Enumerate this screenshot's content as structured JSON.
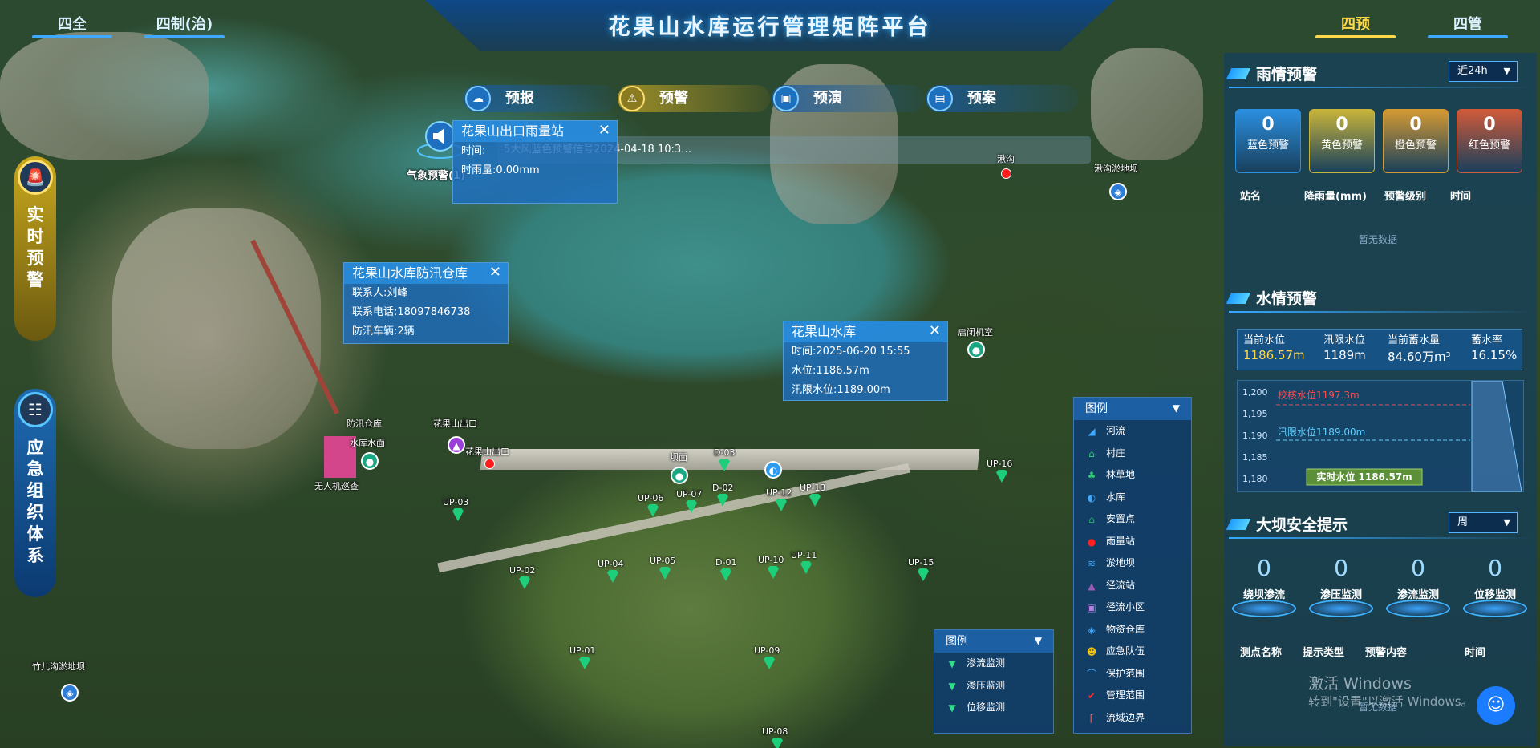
{
  "header": {
    "title": "花果山水库运行管理矩阵平台",
    "left_tabs": [
      "四全",
      "四制(治)"
    ],
    "right_tabs": [
      "四预",
      "四管"
    ],
    "active_right": "四预"
  },
  "subnav": [
    {
      "label": "预报",
      "icon": "cloud-icon"
    },
    {
      "label": "预警",
      "icon": "alarm-icon",
      "active": true
    },
    {
      "label": "预演",
      "icon": "screen-icon"
    },
    {
      "label": "预案",
      "icon": "plan-icon"
    }
  ],
  "sidebar": {
    "realtime": "实时预警",
    "emergency": "应急组织体系"
  },
  "alert": {
    "icon_label": "气象预警(1)",
    "text": "5大风蓝色预警信号2024-04-18 10:3…"
  },
  "popups": {
    "rain_station": {
      "title": "花果山出口雨量站",
      "rows": [
        "时间:",
        "时雨量:0.00mm"
      ]
    },
    "warehouse": {
      "title": "花果山水库防汛仓库",
      "rows": [
        "联系人:刘峰",
        "联系电话:18097846738",
        "防汛车辆:2辆"
      ]
    },
    "reservoir": {
      "title": "花果山水库",
      "rows": [
        "时间:2025-06-20 15:55",
        "水位:1186.57m",
        "汛限水位:1189.00m"
      ]
    }
  },
  "map_labels": {
    "shigou": "湫沟",
    "shigou_dam": "湫沟淤地坝",
    "qibi": "启闭机室",
    "warehouse": "防汛仓库",
    "outlet": "花果山出口",
    "outlet2": "花果山出口",
    "reservoir_mark": "水库水面",
    "drone": "无人机巡查",
    "bamian": "坝面",
    "zhuer": "竹儿沟淤地坝",
    "up": [
      "UP-01",
      "UP-02",
      "UP-03",
      "UP-04",
      "UP-05",
      "UP-06",
      "UP-07",
      "UP-08",
      "UP-09",
      "UP-10",
      "UP-11",
      "UP-12",
      "UP-13",
      "UP-15",
      "UP-16"
    ],
    "d": [
      "D-01",
      "D-02",
      "D-03"
    ]
  },
  "legend_main": {
    "title": "图例",
    "items": [
      {
        "label": "河流",
        "icon": "river-icon",
        "color": "#3fa9ff"
      },
      {
        "label": "村庄",
        "icon": "village-icon",
        "color": "#2ecc71"
      },
      {
        "label": "林草地",
        "icon": "forest-icon",
        "color": "#2ecc71"
      },
      {
        "label": "水库",
        "icon": "reservoir-icon",
        "color": "#3fa9ff"
      },
      {
        "label": "安置点",
        "icon": "shelter-icon",
        "color": "#27ae60"
      },
      {
        "label": "雨量站",
        "icon": "rain-station-icon",
        "color": "#ff2020"
      },
      {
        "label": "淤地坝",
        "icon": "silt-dam-icon",
        "color": "#3fa9ff"
      },
      {
        "label": "径流站",
        "icon": "runoff-station-icon",
        "color": "#9b59b6"
      },
      {
        "label": "径流小区",
        "icon": "runoff-plot-icon",
        "color": "#b07fe0"
      },
      {
        "label": "物资仓库",
        "icon": "warehouse-icon",
        "color": "#3fa9ff"
      },
      {
        "label": "应急队伍",
        "icon": "team-icon",
        "color": "#f1c40f"
      },
      {
        "label": "保护范围",
        "icon": "protect-icon",
        "color": "#3fa9ff"
      },
      {
        "label": "管理范围",
        "icon": "manage-icon",
        "color": "#ff3030"
      },
      {
        "label": "流域边界",
        "icon": "boundary-icon",
        "color": "#ff5a5a"
      }
    ]
  },
  "legend_monitor": {
    "title": "图例",
    "items": [
      {
        "label": "渗流监测"
      },
      {
        "label": "渗压监测"
      },
      {
        "label": "位移监测"
      }
    ]
  },
  "rain": {
    "title": "雨情预警",
    "range": "近24h",
    "cards": [
      {
        "value": "0",
        "label": "蓝色预警",
        "color": "#2b8fe0"
      },
      {
        "value": "0",
        "label": "黄色预警",
        "color": "#c8b43a"
      },
      {
        "value": "0",
        "label": "橙色预警",
        "color": "#d49a33"
      },
      {
        "value": "0",
        "label": "红色预警",
        "color": "#cf5a3a"
      }
    ],
    "columns": [
      "站名",
      "降雨量(mm)",
      "预警级别",
      "时间"
    ],
    "empty": "暂无数据"
  },
  "water": {
    "title": "水情预警",
    "stats": [
      {
        "label": "当前水位",
        "value": "1186.57m",
        "highlight": true
      },
      {
        "label": "汛限水位",
        "value": "1189m"
      },
      {
        "label": "当前蓄水量",
        "value": "84.60万m³"
      },
      {
        "label": "蓄水率",
        "value": "16.15%"
      }
    ],
    "chart": {
      "ticks": [
        "1,200",
        "1,195",
        "1,190",
        "1,185",
        "1,180"
      ],
      "check_level": "校核水位1197.3m",
      "flood_level": "汛限水位1189.00m",
      "realtime": "实时水位 1186.57m"
    }
  },
  "dam": {
    "title": "大坝安全提示",
    "range": "周",
    "rings": [
      {
        "value": "0",
        "label": "绕坝渗流"
      },
      {
        "value": "0",
        "label": "渗压监测"
      },
      {
        "value": "0",
        "label": "渗流监测"
      },
      {
        "value": "0",
        "label": "位移监测"
      }
    ],
    "columns": [
      "测点名称",
      "提示类型",
      "预警内容",
      "时间"
    ],
    "empty": "暂无数据"
  },
  "watermark": {
    "line1": "激活 Windows",
    "line2": "转到\"设置\"以激活 Windows。"
  }
}
